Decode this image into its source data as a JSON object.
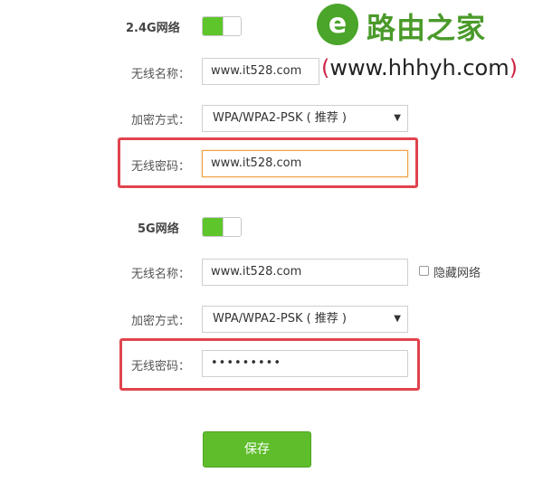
{
  "watermark": {
    "brand": "路由之家",
    "url_open": "(",
    "url": "www.hhhyh.com",
    "url_close": ")",
    "logo_letter": "e"
  },
  "band24": {
    "title": "2.4G网络",
    "toggle_on": true,
    "ssid_label": "无线名称：",
    "ssid_value": "www.it528.com",
    "security_label": "加密方式：",
    "security_value": "WPA/WPA2-PSK ( 推荐 )",
    "password_label": "无线密码：",
    "password_value": "www.it528.com"
  },
  "band5": {
    "title": "5G网络",
    "toggle_on": true,
    "ssid_label": "无线名称：",
    "ssid_value": "www.it528.com",
    "hide_network_label": "隐藏网络",
    "hide_network_checked": false,
    "security_label": "加密方式：",
    "security_value": "WPA/WPA2-PSK ( 推荐 )",
    "password_label": "无线密码：",
    "password_value": "•••••••••"
  },
  "actions": {
    "save_label": "保存"
  },
  "colors": {
    "accent_green": "#5fbd2c",
    "highlight_red": "#e0444e",
    "focus_orange": "#f0a040"
  }
}
